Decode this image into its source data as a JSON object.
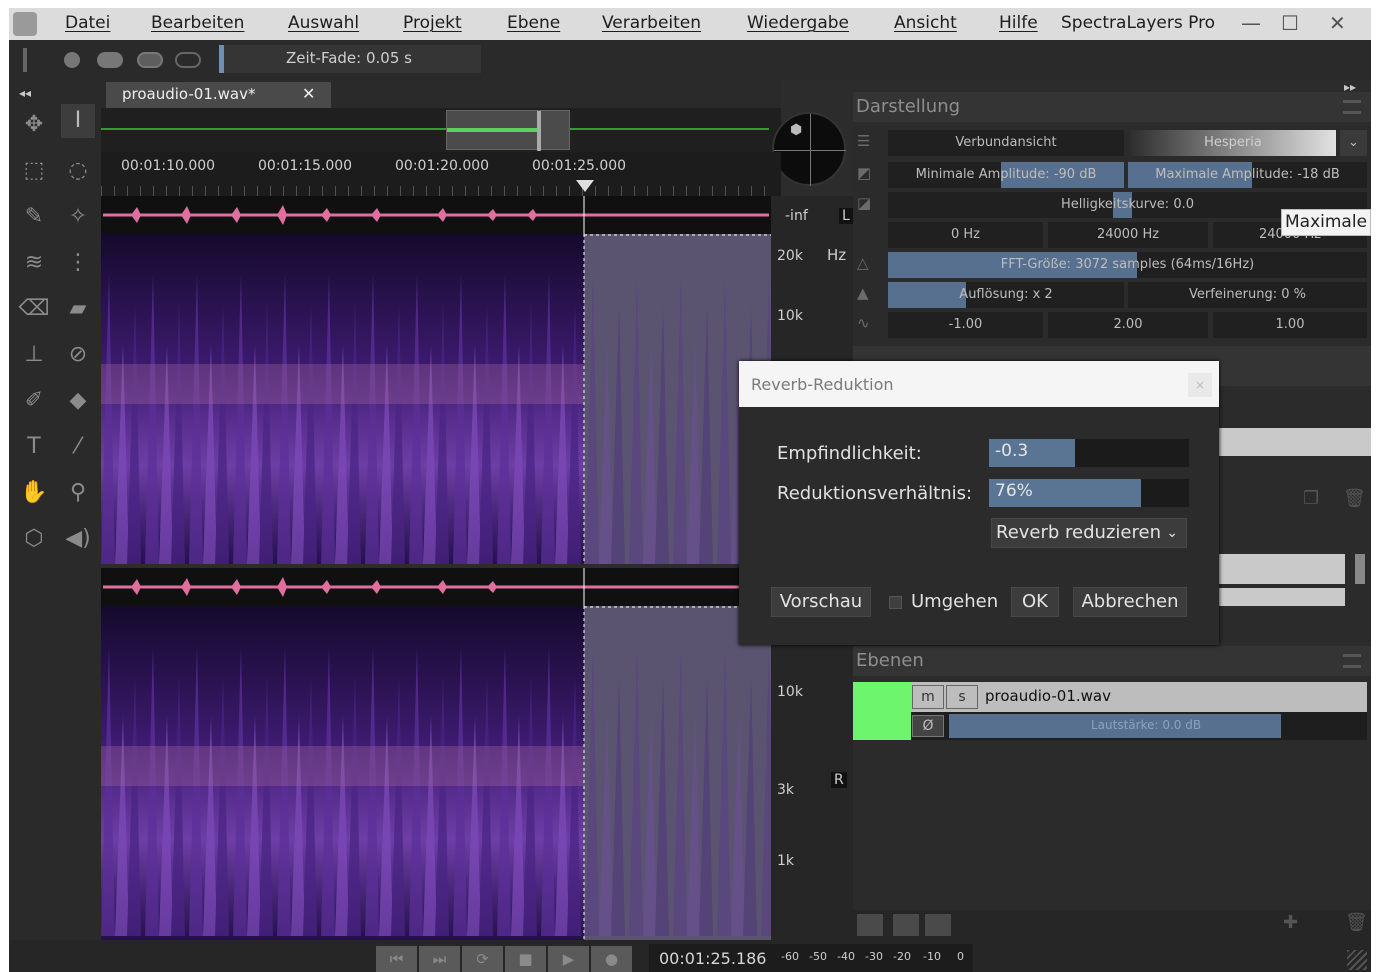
{
  "menu": {
    "items": [
      "Datei",
      "Bearbeiten",
      "Auswahl",
      "Projekt",
      "Ebene",
      "Verarbeiten",
      "Wiedergabe",
      "Ansicht",
      "Hilfe"
    ],
    "app_title": "SpectraLayers Pro",
    "minimize": "—",
    "maximize": "☐",
    "close": "✕"
  },
  "toolbar": {
    "fade_label": "Zeit-Fade: 0.05 s"
  },
  "editor": {
    "tab_label": "proaudio-01.wav*",
    "tab_close": "✕",
    "collapse_left": "◂◂",
    "collapse_right": "▸▸",
    "time_labels": [
      "00:01:10.000",
      "00:01:15.000",
      "00:01:20.000",
      "00:01:25.000"
    ],
    "scale_top": {
      "inf": "-inf",
      "l": "L",
      "k20": "20k",
      "hz": "Hz",
      "k10": "10k"
    },
    "scale_bottom": {
      "k10": "10k",
      "r": "R",
      "k3": "3k",
      "k1": "1k"
    }
  },
  "display_panel": {
    "title": "Darstellung",
    "view_mode": "Verbundansicht",
    "colormap": "Hesperia",
    "min_amp": "Minimale Amplitude: -90 dB",
    "max_amp": "Maximale Amplitude: -18 dB",
    "brightness": "Helligkeitskurve: 0.0",
    "freq_min": "0  Hz",
    "freq_max": "24000  Hz",
    "freq_third": "24000  Hz",
    "fft": "FFT-Größe: 3072 samples (64ms/16Hz)",
    "resolution": "Auflösung: x 2",
    "refinement": "Verfeinerung: 0 %",
    "val1": "-1.00",
    "val2": "2.00",
    "val3": "1.00"
  },
  "layers_panel": {
    "title": "Ebenen",
    "layer_name": "proaudio-01.wav",
    "mute": "m",
    "solo": "s",
    "phase": "Ø",
    "volume": "Lautstärke: 0.0 dB"
  },
  "dialog": {
    "title": "Reverb-Reduktion",
    "close": "×",
    "sensitivity_label": "Empfindlichkeit:",
    "sensitivity_value": "-0.3",
    "sensitivity_fill": 0.43,
    "ratio_label": "Reduktionsverhältnis:",
    "ratio_value": "76%",
    "ratio_fill": 0.76,
    "mode": "Reverb reduzieren",
    "preview": "Vorschau",
    "bypass": "Umgehen",
    "ok": "OK",
    "cancel": "Abbrechen"
  },
  "transport": {
    "time": "00:01:25.186",
    "meter_ticks": [
      "-60",
      "-50",
      "-40",
      "-30",
      "-20",
      "-10",
      "0"
    ]
  },
  "tooltip": "Maximale"
}
